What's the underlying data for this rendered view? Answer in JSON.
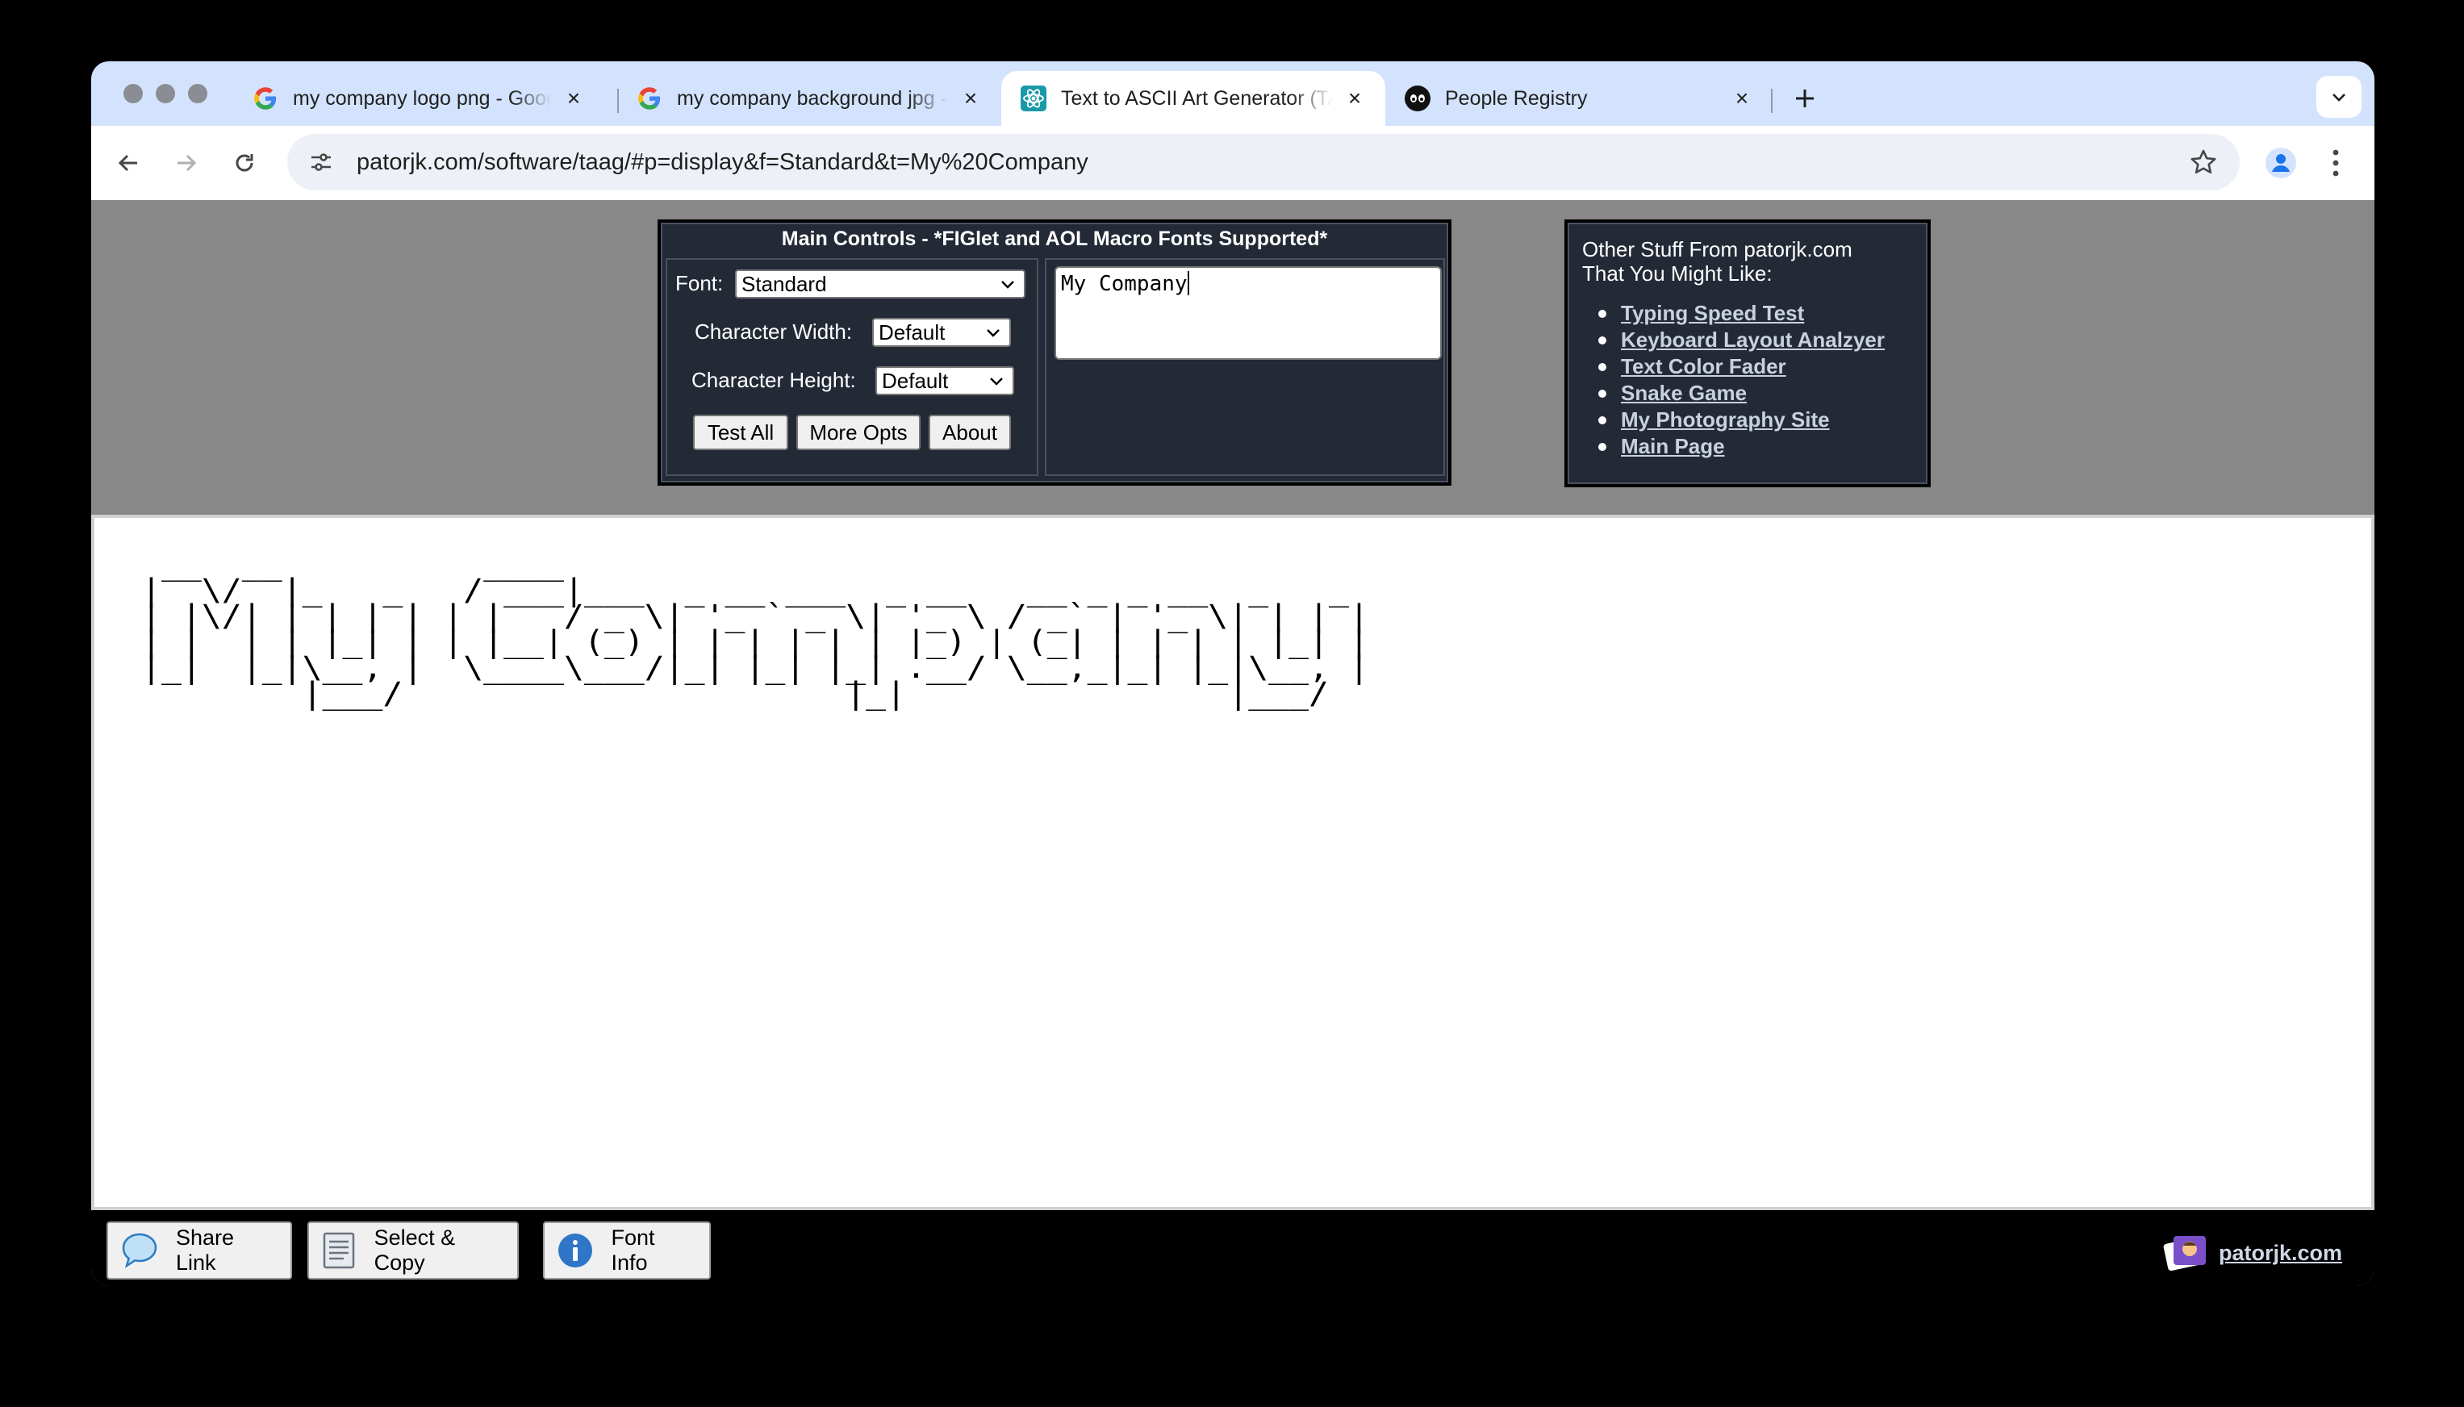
{
  "tabs": [
    {
      "title": "my company logo png - Google Search",
      "favicon": "google-g-icon"
    },
    {
      "title": "my company background jpg - Google Search",
      "favicon": "google-g-icon"
    },
    {
      "title": "Text to ASCII Art Generator (TAAG)",
      "favicon": "react-atom-icon",
      "active": true
    },
    {
      "title": "People Registry",
      "favicon": "eyes-icon"
    }
  ],
  "address": {
    "host": "patorjk.com",
    "path": "/software/taag/#p=display&f=Standard&t=My%20Company"
  },
  "main_controls": {
    "title": "Main Controls - *FIGlet and AOL Macro Fonts Supported*",
    "font_label": "Font:",
    "font_value": "Standard",
    "char_width_label": "Character Width:",
    "char_width_value": "Default",
    "char_height_label": "Character Height:",
    "char_height_value": "Default",
    "test_all": "Test All",
    "more_opts": "More Opts",
    "about": "About",
    "input_text": "My Company"
  },
  "other_stuff": {
    "title_line1": "Other Stuff From patorjk.com",
    "title_line2": "That You Might Like:",
    "links": [
      "Typing Speed Test",
      "Keyboard Layout Analzyer",
      "Text Color Fader",
      "Snake Game",
      "My Photography Site",
      "Main Page"
    ]
  },
  "ascii_output": " __  __          ____                                              \n|  \\/  |_   _   / ___|___  _ __ ___  _ __   __ _ _ __  _   _ \n| |\\/| | | | | | |   / _ \\| '_ ` _ \\| '_ \\ / _` | '_ \\| | | |\n| |  | | |_| | | |__| (_) | | | | | | |_) | (_| | | | | |_| |\n|_|  |_|\\__, |  \\____\\___/|_| |_| |_| .__/ \\__,_|_| |_|\\__, |\n        |___/                      |_|                |___/ ",
  "bottom": {
    "share_link": "Share Link",
    "select_copy": "Select & Copy",
    "font_info": "Font Info",
    "brand": "patorjk.com"
  },
  "colors": {
    "tab_strip": "#d3e3fd",
    "panel": "#232a36",
    "page_bg": "#888888",
    "accent_blue": "#1a73e8"
  }
}
